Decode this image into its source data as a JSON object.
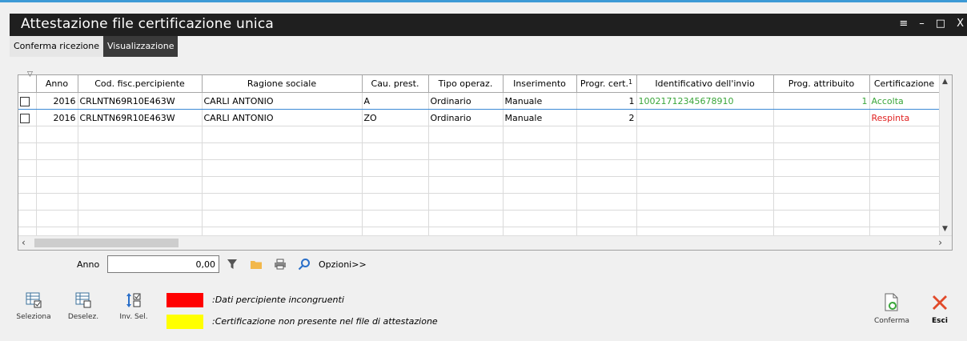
{
  "window": {
    "title": "Attestazione file certificazione unica",
    "controls": [
      "≡",
      "–",
      "□",
      "X"
    ]
  },
  "tabs": [
    {
      "label": "Conferma ricezione",
      "active": false
    },
    {
      "label": "Visualizzazione",
      "active": true
    }
  ],
  "grid": {
    "columns": [
      "Anno",
      "Cod. fisc.percipiente",
      "Ragione sociale",
      "Cau. prest.",
      "Tipo operaz.",
      "Inserimento",
      "Progr. cert.",
      "Identificativo dell'invio",
      "Prog. attribuito",
      "Certificazione"
    ],
    "sort_indicator": "1",
    "rows": [
      {
        "anno": "2016",
        "cf": "CRLNTN69R10E463W",
        "ragione": "CARLI ANTONIO",
        "cau": "A",
        "tipo": "Ordinario",
        "ins": "Manuale",
        "progr": "1",
        "ident": "10021712345678910",
        "prog_attr": "1",
        "cert": "Accolta"
      },
      {
        "anno": "2016",
        "cf": "CRLNTN69R10E463W",
        "ragione": "CARLI ANTONIO",
        "cau": "ZO",
        "tipo": "Ordinario",
        "ins": "Manuale",
        "progr": "2",
        "ident": "",
        "prog_attr": "",
        "cert": "Respinta"
      }
    ]
  },
  "filter": {
    "anno_label": "Anno",
    "anno_value": "0,00",
    "opzioni_label": "Opzioni>>"
  },
  "buttons": {
    "seleziona": "Seleziona",
    "deselez": "Deselez.",
    "inv_sel": "Inv. Sel.",
    "conferma": "Conferma",
    "esci": "Esci"
  },
  "legend": [
    {
      "color": "#ff0000",
      "text": ":Dati percipiente incongruenti"
    },
    {
      "color": "#ffff00",
      "text": ":Certificazione non presente nel file di attestazione"
    }
  ],
  "colors": {
    "accent": "#3c9ad6",
    "status_ok": "#3aa63a",
    "status_ko": "#e02020",
    "titlebar": "#1f1f1f"
  }
}
